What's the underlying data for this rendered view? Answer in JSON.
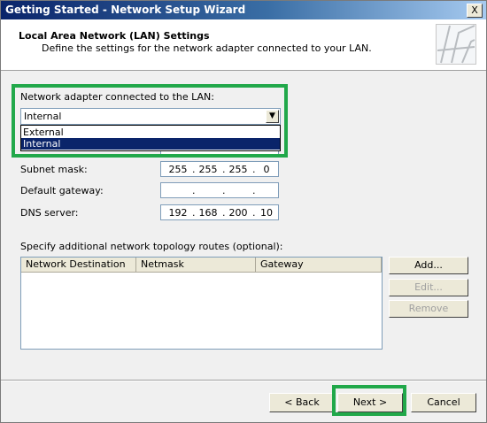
{
  "window": {
    "title": "Getting Started - Network Setup Wizard",
    "close_label": "X"
  },
  "header": {
    "title": "Local Area Network (LAN) Settings",
    "subtitle": "Define the settings for the network adapter connected to your LAN."
  },
  "adapter": {
    "label": "Network adapter connected to the LAN:",
    "selected": "Internal",
    "options": [
      "External",
      "Internal"
    ]
  },
  "subnet": {
    "label": "Subnet mask:",
    "octets": [
      "255",
      "255",
      "255",
      "0"
    ]
  },
  "gateway": {
    "label": "Default gateway:",
    "octets": [
      "",
      "",
      "",
      ""
    ]
  },
  "dns": {
    "label": "DNS server:",
    "octets": [
      "192",
      "168",
      "200",
      "10"
    ]
  },
  "routes": {
    "label": "Specify additional network topology routes (optional):",
    "columns": [
      "Network Destination",
      "Netmask",
      "Gateway"
    ],
    "add": "Add...",
    "edit": "Edit...",
    "remove": "Remove"
  },
  "footer": {
    "back": "< Back",
    "next": "Next >",
    "cancel": "Cancel"
  },
  "highlight_color": "#21a84a"
}
